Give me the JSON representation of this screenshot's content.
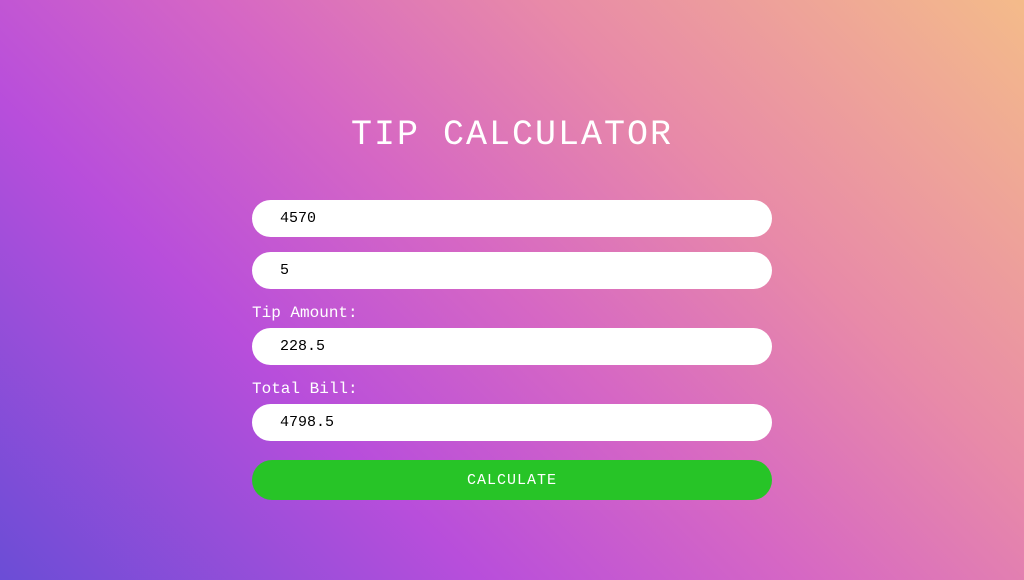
{
  "title": "TIP CALCULATOR",
  "inputs": {
    "bill": "4570",
    "tipPercent": "5",
    "tipAmount": "228.5",
    "totalBill": "4798.5"
  },
  "labels": {
    "tipAmount": "Tip Amount:",
    "totalBill": "Total Bill:"
  },
  "button": "CALCULATE"
}
